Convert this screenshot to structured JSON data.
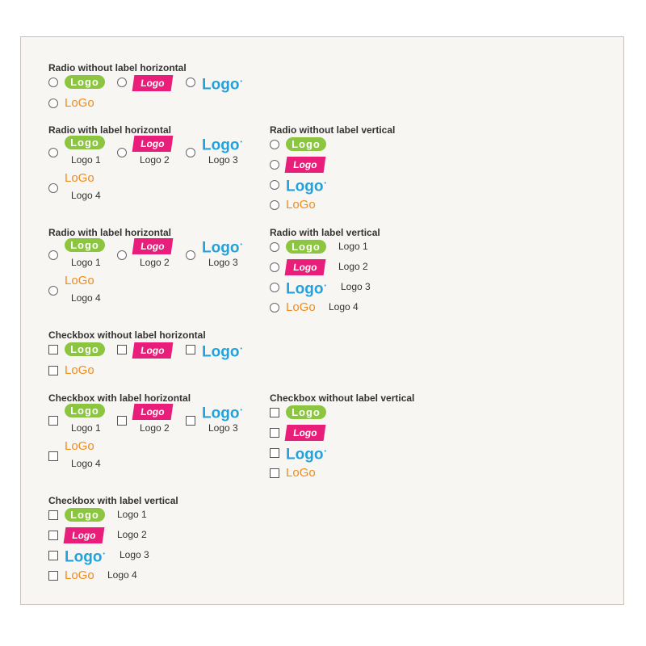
{
  "logos": [
    "Logo",
    "Logo",
    "Logo",
    "LoGo"
  ],
  "labels": [
    "Logo 1",
    "Logo 2",
    "Logo 3",
    "Logo 4"
  ],
  "colors": {
    "green": "#8cc540",
    "pink": "#e91e7a",
    "blue": "#22a2dc",
    "orange": "#f08c1a",
    "panel": "#f8f6f3",
    "border": "#c9c2b8"
  },
  "sections": [
    {
      "title": "Radio without label horizontal",
      "control": "radio",
      "labeled": false,
      "layout": "horizontal"
    },
    {
      "title": "Radio with label horizontal",
      "control": "radio",
      "labeled": true,
      "layout": "horizontal"
    },
    {
      "title": "Radio without label vertical",
      "control": "radio",
      "labeled": false,
      "layout": "vertical"
    },
    {
      "title": "Radio with label horizontal",
      "control": "radio",
      "labeled": true,
      "layout": "horizontal"
    },
    {
      "title": "Radio with label vertical",
      "control": "radio",
      "labeled": true,
      "layout": "vertical"
    },
    {
      "title": "Checkbox without label horizontal",
      "control": "checkbox",
      "labeled": false,
      "layout": "horizontal"
    },
    {
      "title": "Checkbox with label horizontal",
      "control": "checkbox",
      "labeled": true,
      "layout": "horizontal"
    },
    {
      "title": "Checkbox without label vertical",
      "control": "checkbox",
      "labeled": false,
      "layout": "vertical"
    },
    {
      "title": "Checkbox with label vertical",
      "control": "checkbox",
      "labeled": true,
      "layout": "vertical"
    }
  ]
}
